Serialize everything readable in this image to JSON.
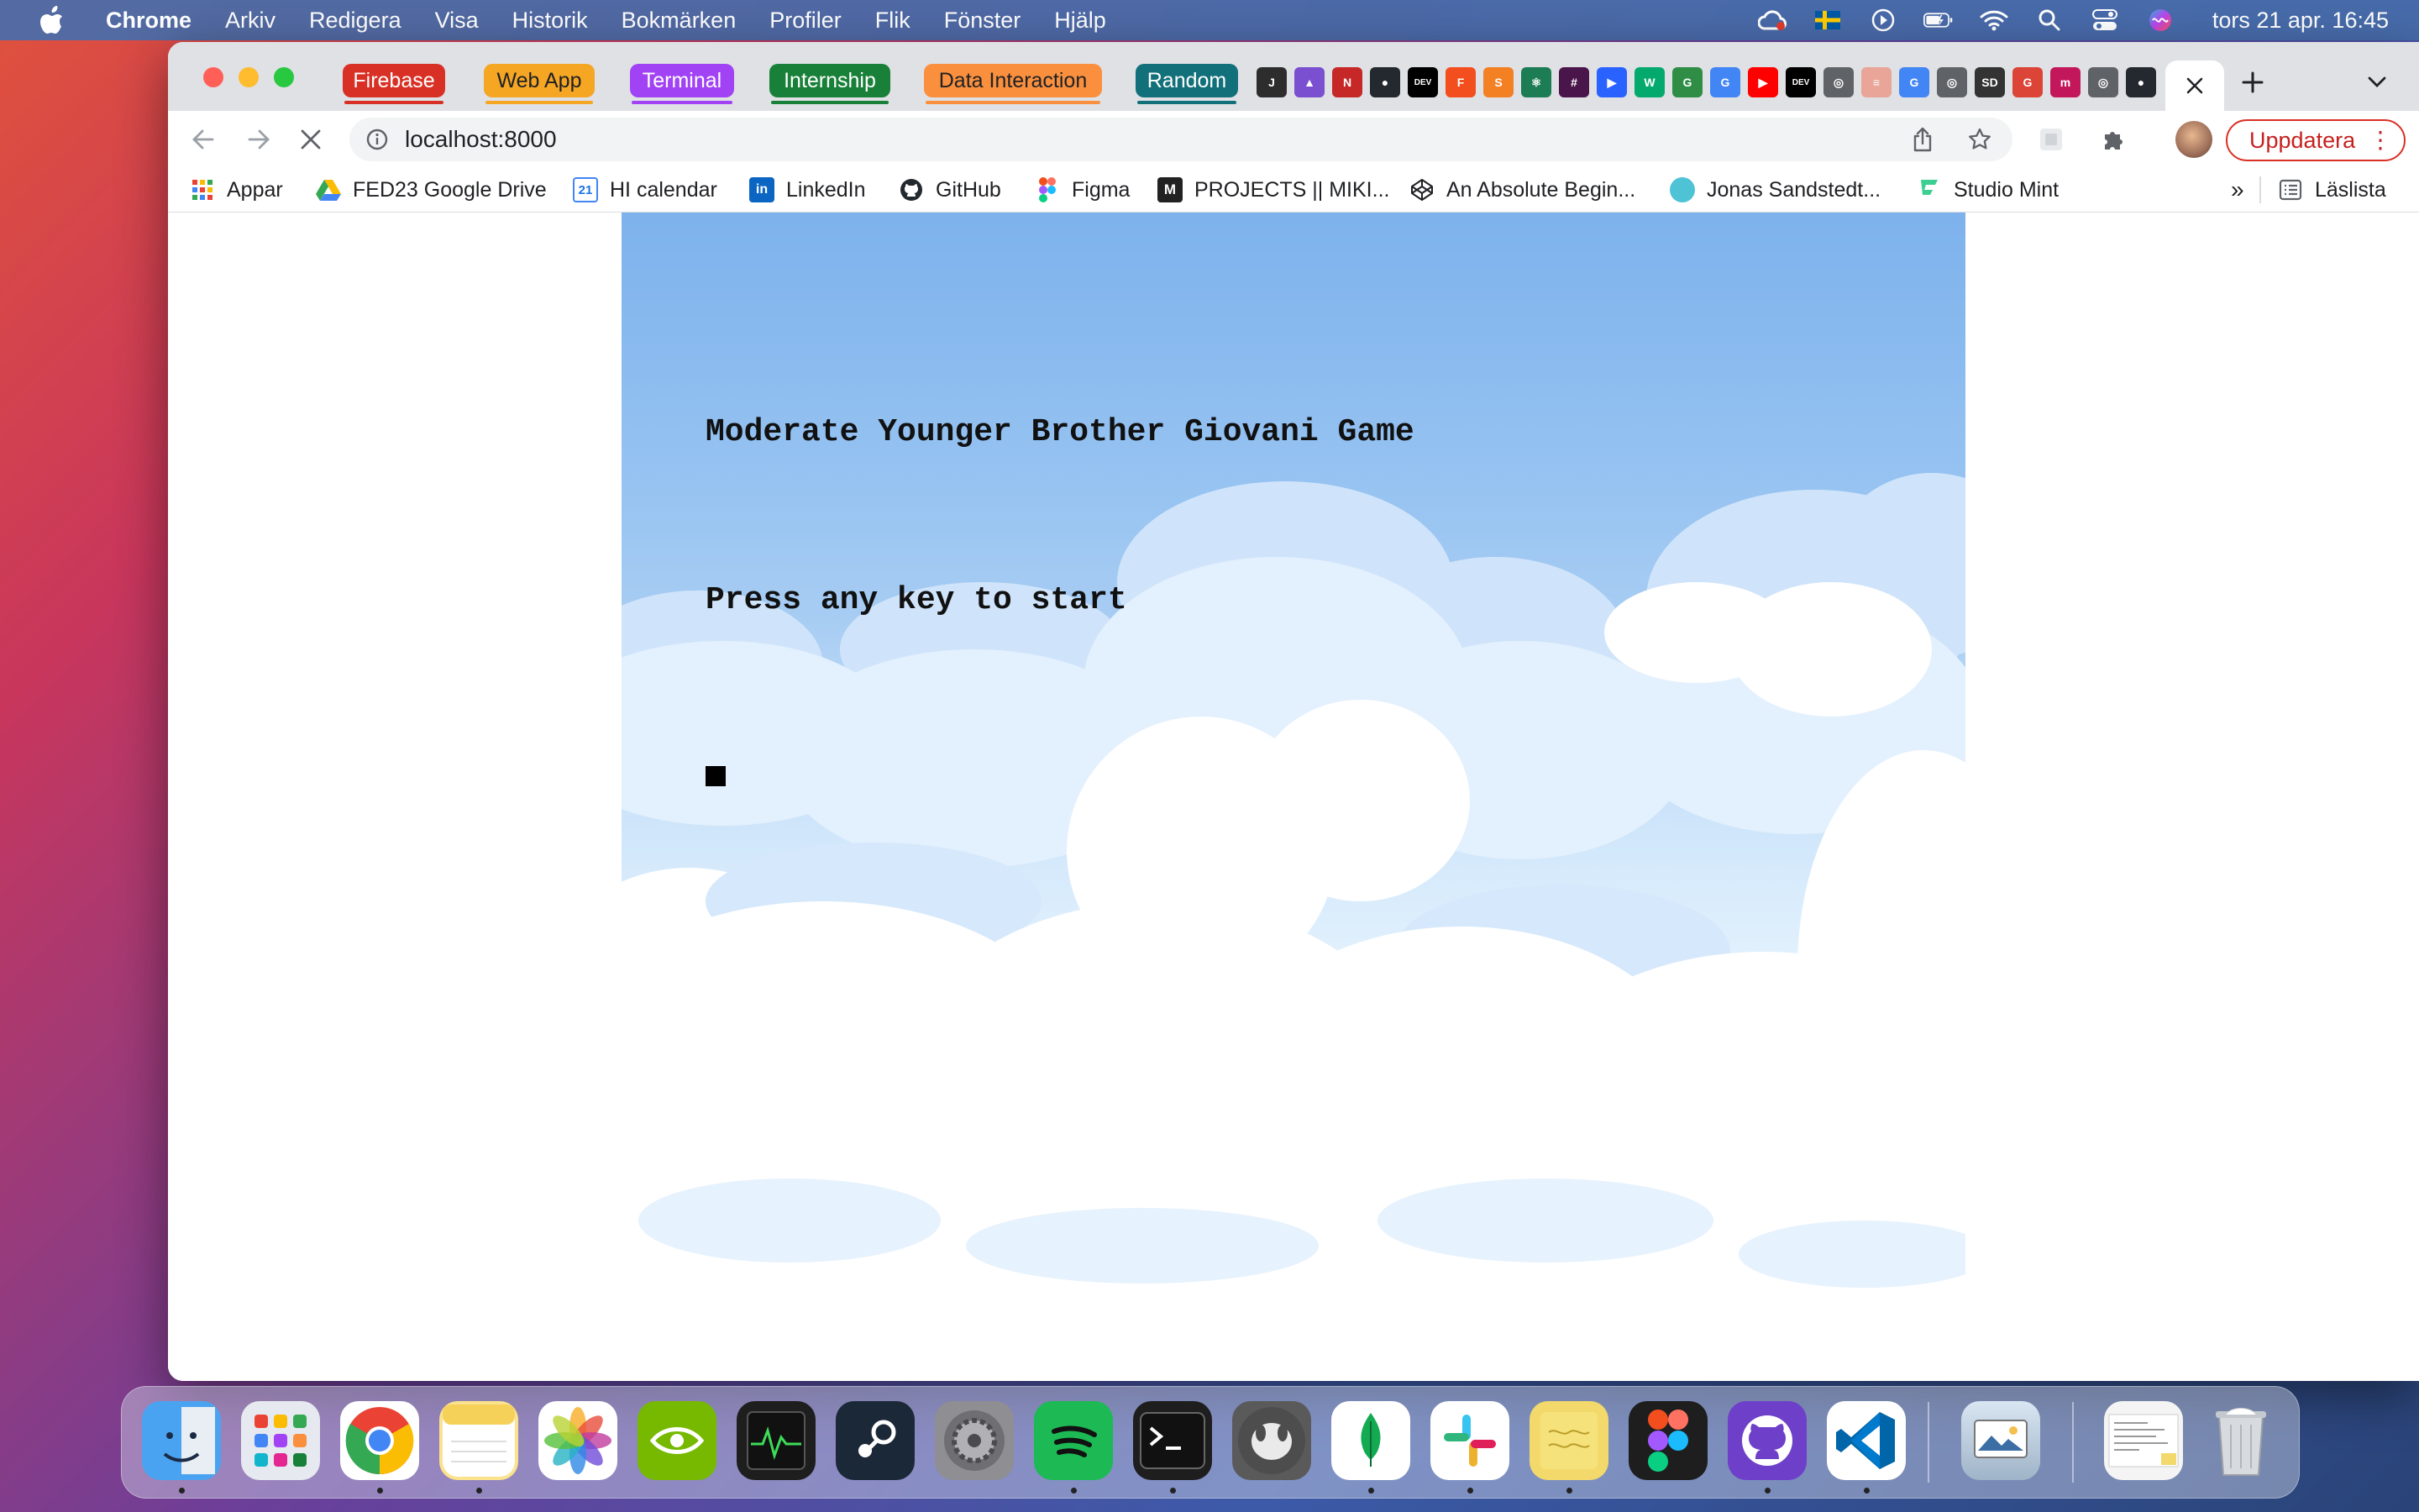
{
  "menubar": {
    "app_name": "Chrome",
    "items": [
      "Arkiv",
      "Redigera",
      "Visa",
      "Historik",
      "Bokmärken",
      "Profiler",
      "Flik",
      "Fönster",
      "Hjälp"
    ],
    "clock": "tors 21 apr.  16:45"
  },
  "tab_groups": [
    {
      "label": "Firebase",
      "color": "#d93025"
    },
    {
      "label": "Web App",
      "color": "#f5a623"
    },
    {
      "label": "Terminal",
      "color": "#a142f4"
    },
    {
      "label": "Internship",
      "color": "#188038"
    },
    {
      "label": "Data Interaction",
      "color": "#fa903e"
    },
    {
      "label": "Random",
      "color": "#12707a"
    }
  ],
  "pinned_tab_icons": [
    {
      "name": "jira",
      "text": "J",
      "color": "#2d2d2d"
    },
    {
      "name": "rocket",
      "text": "▲",
      "color": "#7a4fd0"
    },
    {
      "name": "vercel",
      "text": "N",
      "color": "#c62828"
    },
    {
      "name": "github",
      "text": "●",
      "color": "#24292f"
    },
    {
      "name": "dev",
      "text": "DEV",
      "color": "#000000"
    },
    {
      "name": "figma",
      "text": "F",
      "color": "#f24e1e"
    },
    {
      "name": "stackoverflow",
      "text": "S",
      "color": "#f48024"
    },
    {
      "name": "react",
      "text": "⚛",
      "color": "#1c7c54"
    },
    {
      "name": "slack",
      "text": "#",
      "color": "#4a154b"
    },
    {
      "name": "jsfiddle",
      "text": "▶",
      "color": "#2962ff"
    },
    {
      "name": "w3",
      "text": "W",
      "color": "#04aa6d"
    },
    {
      "name": "geeks",
      "text": "G",
      "color": "#2f8d46"
    },
    {
      "name": "google",
      "text": "G",
      "color": "#4285f4"
    },
    {
      "name": "youtube",
      "text": "▶",
      "color": "#ff0000"
    },
    {
      "name": "dev2",
      "text": "DEV",
      "color": "#000000"
    },
    {
      "name": "globe",
      "text": "◎",
      "color": "#5f6368"
    },
    {
      "name": "doc",
      "text": "≡",
      "color": "#e8a598"
    },
    {
      "name": "google2",
      "text": "G",
      "color": "#4285f4"
    },
    {
      "name": "globe2",
      "text": "◎",
      "color": "#5f6368"
    },
    {
      "name": "sd",
      "text": "SD",
      "color": "#333333"
    },
    {
      "name": "google3",
      "text": "G",
      "color": "#db4437"
    },
    {
      "name": "medium",
      "text": "m",
      "color": "#c2185b"
    },
    {
      "name": "globe3",
      "text": "◎",
      "color": "#5f6368"
    },
    {
      "name": "github2",
      "text": "●",
      "color": "#24292f"
    }
  ],
  "address_bar": {
    "url": "localhost:8000"
  },
  "update_button": "Uppdatera",
  "bookmarks": [
    {
      "label": "Appar",
      "icon": "apps-grid-icon"
    },
    {
      "label": "FED23 Google Drive",
      "icon": "drive-icon"
    },
    {
      "label": "HI calendar",
      "icon": "calendar-icon"
    },
    {
      "label": "LinkedIn",
      "icon": "linkedin-icon"
    },
    {
      "label": "GitHub",
      "icon": "github-icon"
    },
    {
      "label": "Figma",
      "icon": "figma-icon"
    },
    {
      "label": "PROJECTS || MIKI...",
      "icon": "medium-icon"
    },
    {
      "label": "An Absolute Begin...",
      "icon": "codepen-icon"
    },
    {
      "label": "Jonas Sandstedt...",
      "icon": "site-icon"
    },
    {
      "label": "Studio Mint",
      "icon": "mint-icon"
    }
  ],
  "bookmarks_overflow": "»",
  "reading_list": "Läslista",
  "game": {
    "title": "Moderate Younger Brother Giovani Game",
    "prompt": "Press any key to start"
  },
  "dock_apps": [
    {
      "name": "finder",
      "bg": "#4aa3f0",
      "running": true
    },
    {
      "name": "launchpad",
      "bg": "#e6e9ef",
      "running": false
    },
    {
      "name": "chrome",
      "bg": "#ffffff",
      "running": true
    },
    {
      "name": "notes",
      "bg": "#fbe38e",
      "running": true
    },
    {
      "name": "photos",
      "bg": "#ffffff",
      "running": false
    },
    {
      "name": "nvidia",
      "bg": "#76b900",
      "running": false
    },
    {
      "name": "activity-monitor",
      "bg": "#1e1e1e",
      "running": false
    },
    {
      "name": "steam",
      "bg": "#1b2838",
      "running": false
    },
    {
      "name": "system-preferences",
      "bg": "#8e8e93",
      "running": false
    },
    {
      "name": "spotify",
      "bg": "#1db954",
      "running": true
    },
    {
      "name": "terminal",
      "bg": "#1e1e1e",
      "running": true
    },
    {
      "name": "tableplus",
      "bg": "#5a5a5a",
      "running": false
    },
    {
      "name": "mongodb",
      "bg": "#ffffff",
      "running": true
    },
    {
      "name": "slack",
      "bg": "#ffffff",
      "running": true
    },
    {
      "name": "stickies",
      "bg": "#f3d96b",
      "running": true
    },
    {
      "name": "figma",
      "bg": "#1e1e1e",
      "running": false
    },
    {
      "name": "github-desktop",
      "bg": "#6e40c9",
      "running": true
    },
    {
      "name": "vscode",
      "bg": "#ffffff",
      "running": true
    }
  ],
  "colors": {
    "menubar": "#466eaa",
    "update_border": "#d93025",
    "game_sky_top": "#7eb2ec"
  }
}
